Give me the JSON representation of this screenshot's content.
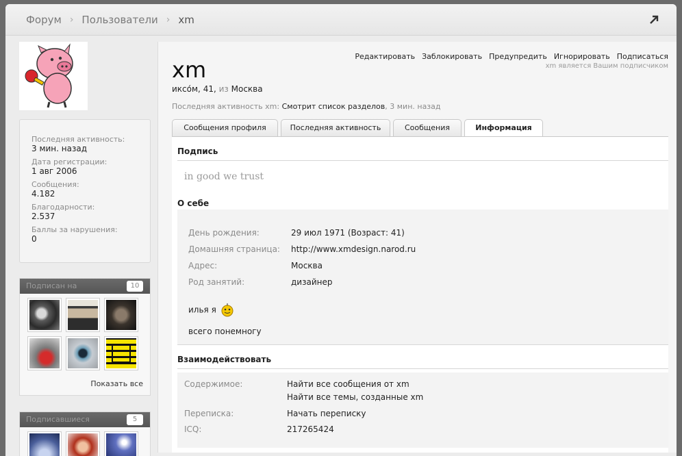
{
  "breadcrumb": {
    "items": [
      "Форум",
      "Пользователи"
    ],
    "current": "xm"
  },
  "sidebar": {
    "stats": [
      {
        "label": "Последняя активность:",
        "value": "3 мин. назад"
      },
      {
        "label": "Дата регистрации:",
        "value": "1 авг 2006"
      },
      {
        "label": "Сообщения:",
        "value": "4.182"
      },
      {
        "label": "Благодарности:",
        "value": "2.537"
      },
      {
        "label": "Баллы за нарушения:",
        "value": "0"
      }
    ],
    "following": {
      "title": "Подписан на",
      "count": "10",
      "show_all": "Показать все"
    },
    "followers": {
      "title": "Подписавшиеся",
      "count": "5"
    }
  },
  "profile": {
    "username": "xm",
    "sub": {
      "nick": "иксо́м",
      "age": "41",
      "from_word": "из",
      "location": "Москва"
    },
    "last_activity": {
      "label": "Последняя активность xm:",
      "action": "Смотрит список разделов",
      "time": "3 мин. назад"
    },
    "actions": [
      "Редактировать",
      "Заблокировать",
      "Предупредить",
      "Игнорировать",
      "Подписаться"
    ],
    "subscribed_note": "xm является Вашим подписчиком"
  },
  "tabs": [
    "Сообщения профиля",
    "Последняя активность",
    "Сообщения",
    "Информация"
  ],
  "info": {
    "signature_title": "Подпись",
    "signature": "in good we trust",
    "about_title": "О себе",
    "fields": [
      {
        "label": "День рождения:",
        "value": "29 июл 1971 (Возраст: 41)"
      },
      {
        "label": "Домашняя страница:",
        "value": "http://www.xmdesign.narod.ru"
      },
      {
        "label": "Адрес:",
        "value": "Москва"
      },
      {
        "label": "Род занятий:",
        "value": "дизайнер"
      }
    ],
    "about_text": "илья я",
    "about_text2": "всего понемногу",
    "interact_title": "Взаимодействовать",
    "content_label": "Содержимое:",
    "find_posts": "Найти все сообщения от xm",
    "find_threads": "Найти все темы, созданные xm",
    "conversation_label": "Переписка:",
    "start_conversation": "Начать переписку",
    "icq_label": "ICQ:",
    "icq_value": "217265424"
  }
}
